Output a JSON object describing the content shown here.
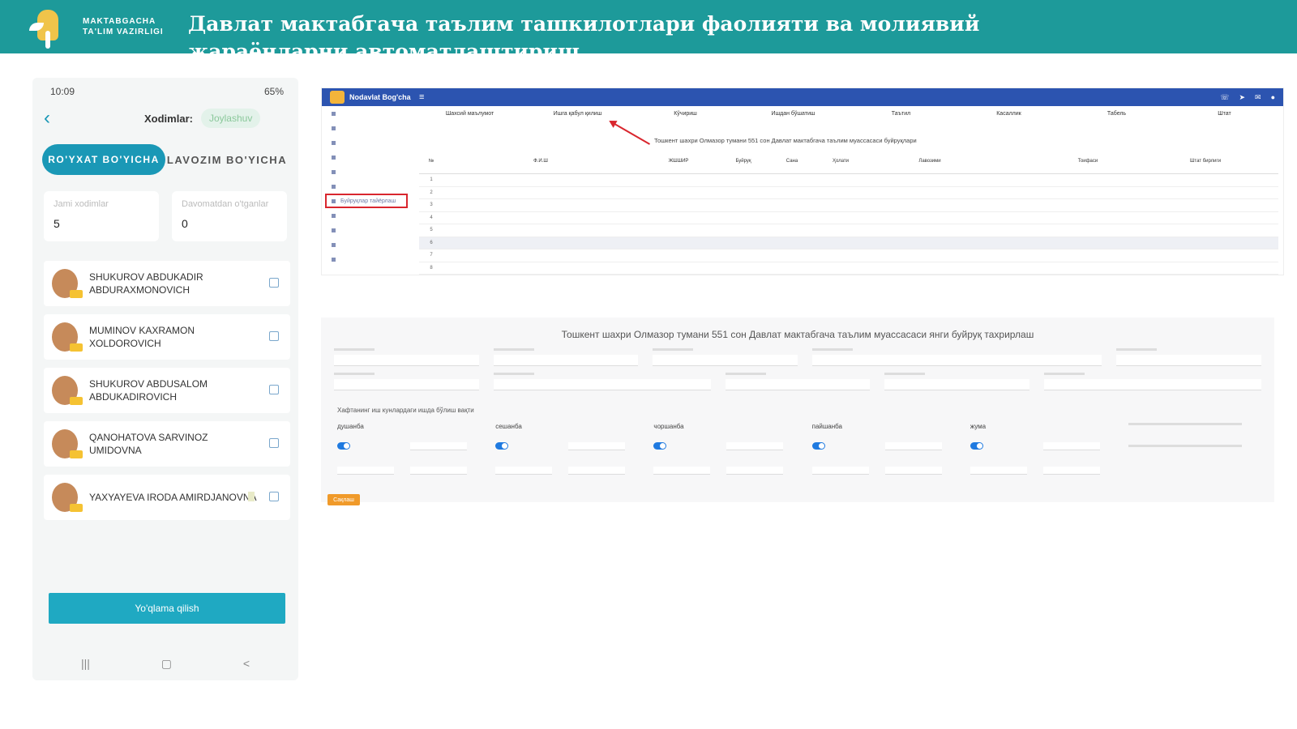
{
  "banner": {
    "logo_text": "MAKTABGACHA TA'LIM VAZIRLIGI",
    "title": "Давлат мактабгача таълим ташкилотлари фаолияти ва молиявий жараёнларни автоматлаштириш"
  },
  "phone": {
    "status_time": "10:09",
    "status_battery": "65%",
    "header_label": "Xodimlar:",
    "header_user": "Joylashuv",
    "tabs": [
      {
        "label": "RO'YXAT BO'YICHA",
        "active": true
      },
      {
        "label": "LAVOZIM BO'YICHA",
        "active": false
      }
    ],
    "stats": [
      {
        "label": "Jami xodimlar",
        "value": "5"
      },
      {
        "label": "Davomatdan o'tganlar",
        "value": "0"
      }
    ],
    "employees": [
      {
        "name": "SHUKUROV ABDUKADIR ABDURAXMONOVICH"
      },
      {
        "name": "MUMINOV KAXRAMON XOLDOROVICH"
      },
      {
        "name": "SHUKUROV ABDUSALOM ABDUKADIROVICH"
      },
      {
        "name": "QANOHATOVA SARVINOZ UMIDOVNA"
      },
      {
        "name": "YAXYAYEVA IRODA AMIRDJANOVNA"
      }
    ],
    "action_button": "Yo'qlama qilish",
    "nav": [
      "|||",
      "▢",
      "<"
    ]
  },
  "desktop": {
    "brand": "Nodavlat Bog'cha",
    "menu_icon": "≡",
    "tabs": [
      "Шахсий маълумот",
      "Ишга қабул қилиш",
      "Кўчириш",
      "Ишдан бўшатиш",
      "Таътил",
      "Касаллик",
      "Табель",
      "Штат"
    ],
    "note": "Тошкент шахри Олмазор тумани 551 сон Давлат мактабгача таълим муассасаси буйруқлари",
    "sidebar_highlight": "Буйруқлар тайёрлаш",
    "table_headers": [
      "№",
      "Ф.И.Ш",
      "ЖШШИР",
      "Буйруқ",
      "Сана",
      "Ҳолати",
      "Лавозими",
      "Тоифаси",
      "Штат бирлиги"
    ],
    "row_numbers": [
      "1",
      "2",
      "3",
      "4",
      "5",
      "6",
      "7",
      "8"
    ]
  },
  "form": {
    "title": "Тошкент шахри Олмазор тумани 551 сон Давлат мактабгача таълим муассасаси янги буйруқ тахрирлаш",
    "week_label": "Хафтанинг иш кунлардаги ишда бўлиш вақти",
    "days": [
      "душанба",
      "сешанба",
      "чоршанба",
      "пайшанба",
      "жума"
    ],
    "save_label": "Сақлаш"
  }
}
